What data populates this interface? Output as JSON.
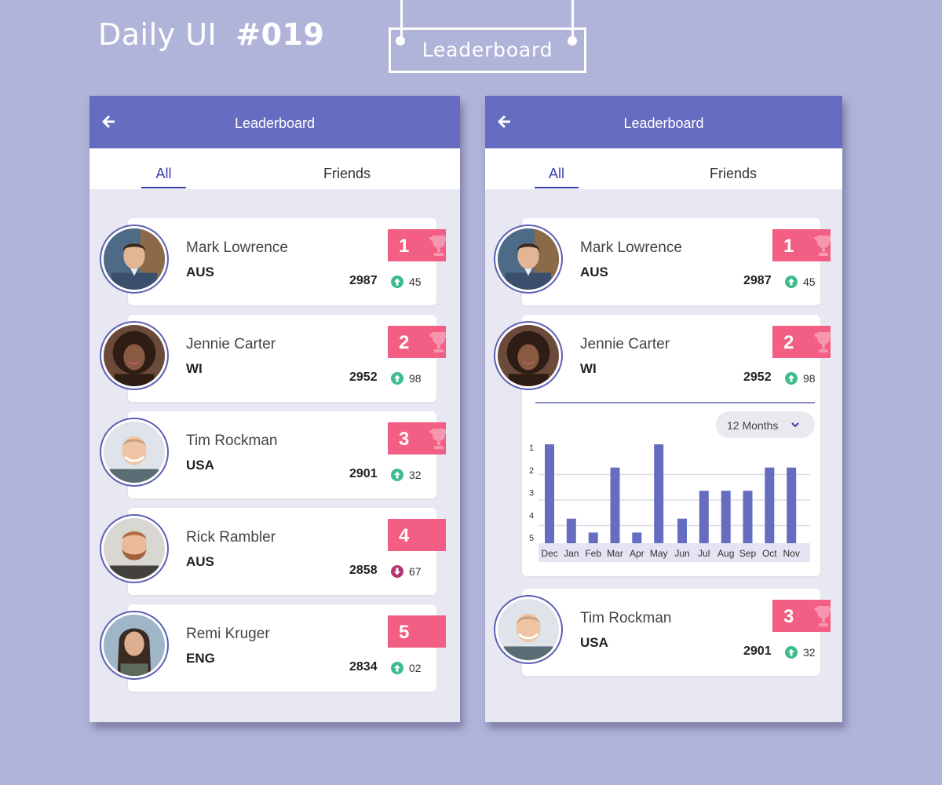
{
  "header_title": "Daily UI",
  "header_number": "#019",
  "sign_label": "Leaderboard",
  "colors": {
    "background": "#b1b4d9",
    "accent": "#666cc0",
    "rank": "#f35e84",
    "up": "#3dbd8b",
    "down": "#b33672"
  },
  "screen": {
    "title": "Leaderboard",
    "tabs": [
      {
        "label": "All",
        "active": true
      },
      {
        "label": "Friends",
        "active": false
      }
    ]
  },
  "left_list": [
    {
      "rank": "1",
      "name": "Mark Lowrence",
      "country": "AUS",
      "score": "2987",
      "change": "45",
      "direction": "up",
      "trophy": true
    },
    {
      "rank": "2",
      "name": "Jennie Carter",
      "country": "WI",
      "score": "2952",
      "change": "98",
      "direction": "up",
      "trophy": true
    },
    {
      "rank": "3",
      "name": "Tim Rockman",
      "country": "USA",
      "score": "2901",
      "change": "32",
      "direction": "up",
      "trophy": true
    },
    {
      "rank": "4",
      "name": "Rick Rambler",
      "country": "AUS",
      "score": "2858",
      "change": "67",
      "direction": "down",
      "trophy": false
    },
    {
      "rank": "5",
      "name": "Remi Kruger",
      "country": "ENG",
      "score": "2834",
      "change": "02",
      "direction": "up",
      "trophy": false
    }
  ],
  "right_list": [
    {
      "rank": "1",
      "name": "Mark Lowrence",
      "country": "AUS",
      "score": "2987",
      "change": "45",
      "direction": "up",
      "trophy": true
    },
    {
      "rank": "2",
      "name": "Jennie Carter",
      "country": "WI",
      "score": "2952",
      "change": "98",
      "direction": "up",
      "trophy": true
    },
    {
      "rank": "3",
      "name": "Tim Rockman",
      "country": "USA",
      "score": "2901",
      "change": "32",
      "direction": "up",
      "trophy": true
    }
  ],
  "rank_history": {
    "period": "12 Months"
  },
  "chart_data": {
    "type": "bar",
    "categories": [
      "Dec",
      "Jan",
      "Feb",
      "Mar",
      "Apr",
      "May",
      "Jun",
      "Jul",
      "Aug",
      "Sep",
      "Oct",
      "Nov"
    ],
    "values": [
      1,
      4.2,
      4.8,
      2,
      4.8,
      1,
      4.2,
      3,
      3,
      3,
      2,
      2
    ],
    "y_ticks": [
      "1",
      "2",
      "3",
      "4",
      "5"
    ],
    "ylim": [
      1,
      5
    ],
    "y_inverted": true,
    "grid": true,
    "bar_color": "#666cc0"
  }
}
